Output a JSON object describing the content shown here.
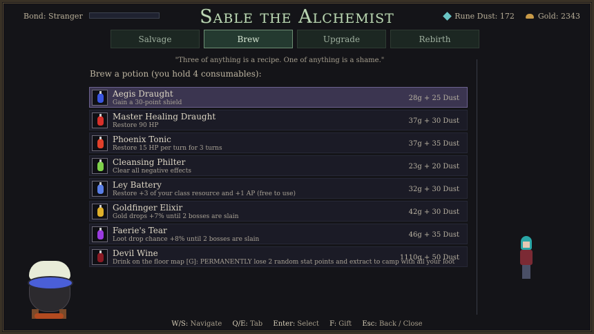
{
  "header": {
    "bond": "Bond: Stranger",
    "bond_progress": 0,
    "title": "Sable the Alchemist",
    "rune_dust": "Rune Dust: 172",
    "gold": "Gold: 2343"
  },
  "tabs": [
    {
      "label": "Salvage",
      "active": false
    },
    {
      "label": "Brew",
      "active": true
    },
    {
      "label": "Upgrade",
      "active": false
    },
    {
      "label": "Rebirth",
      "active": false
    }
  ],
  "quote": "\"Three of anything is a recipe. One of anything is a shame.\"",
  "prompt": "Brew a potion  (you hold 4 consumables):",
  "potions": [
    {
      "name": "Aegis Draught",
      "desc": "Gain a 30-point shield",
      "cost": "28g  +  25 Dust",
      "color": "#3a56e0",
      "icon": "blue-potion-icon",
      "selected": true
    },
    {
      "name": "Master Healing Draught",
      "desc": "Restore 90 HP",
      "cost": "37g  +  30 Dust",
      "color": "#d8302a",
      "icon": "red-potion-icon",
      "selected": false
    },
    {
      "name": "Phoenix Tonic",
      "desc": "Restore 15 HP per turn for 3 turns",
      "cost": "37g  +  35 Dust",
      "color": "#e0402a",
      "icon": "flame-potion-icon",
      "selected": false
    },
    {
      "name": "Cleansing Philter",
      "desc": "Clear all negative effects",
      "cost": "23g  +  20 Dust",
      "color": "#7ed04a",
      "icon": "green-potion-icon",
      "selected": false
    },
    {
      "name": "Ley Battery",
      "desc": "Restore +3 of your class resource and +1 AP (free to use)",
      "cost": "32g  +  30 Dust",
      "color": "#5a7ee6",
      "icon": "mana-potion-icon",
      "selected": false
    },
    {
      "name": "Goldfinger Elixir",
      "desc": "Gold drops +7% until 2 bosses are slain",
      "cost": "42g  +  30 Dust",
      "color": "#e0b02a",
      "icon": "gold-potion-icon",
      "selected": false
    },
    {
      "name": "Faerie's Tear",
      "desc": "Loot drop chance +8% until 2 bosses are slain",
      "cost": "46g  +  35 Dust",
      "color": "#9a3ae0",
      "icon": "purple-potion-icon",
      "selected": false
    },
    {
      "name": "Devil Wine",
      "desc": "Drink on the floor map [G]: PERMANENTLY lose 2 random stat points and extract to camp with all your loot",
      "cost": "1110g  +  50 Dust",
      "color": "#8a1a24",
      "icon": "wine-bottle-icon",
      "selected": false
    }
  ],
  "footer": [
    {
      "key": "W/S:",
      "label": "Navigate"
    },
    {
      "key": "Q/E:",
      "label": "Tab"
    },
    {
      "key": "Enter:",
      "label": "Select"
    },
    {
      "key": "F:",
      "label": "Gift"
    },
    {
      "key": "Esc:",
      "label": "Back / Close"
    }
  ]
}
